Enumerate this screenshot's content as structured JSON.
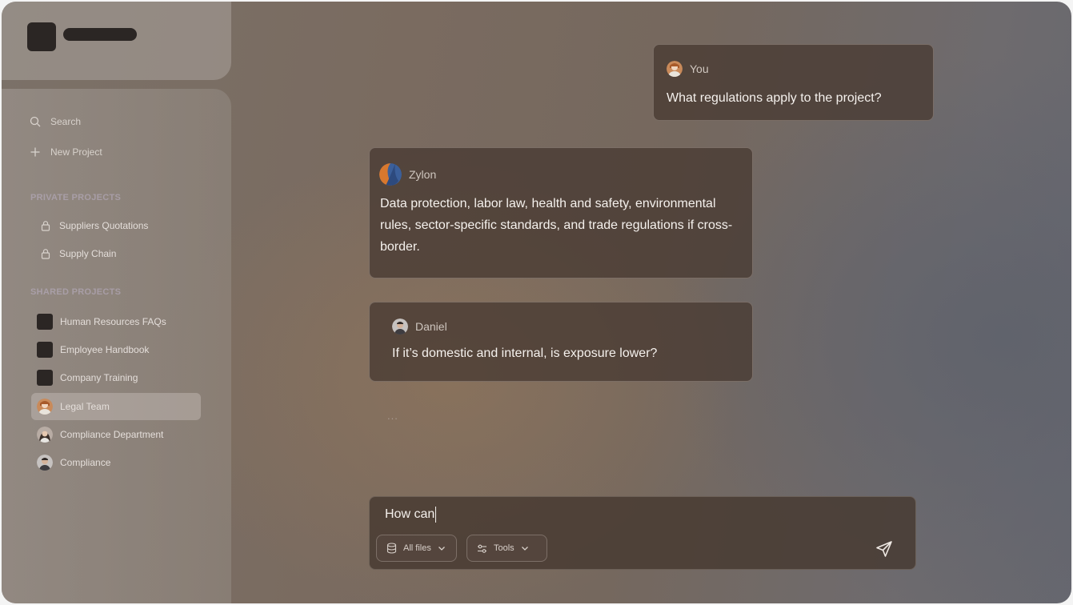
{
  "sidebar": {
    "search_label": "Search",
    "new_project_label": "New Project",
    "private_section_label": "PRIVATE PROJECTS",
    "private_projects": [
      {
        "label": "Suppliers Quotations",
        "icon": "lock-icon"
      },
      {
        "label": "Supply Chain",
        "icon": "lock-icon"
      }
    ],
    "shared_section_label": "SHARED PROJECTS",
    "shared_projects": [
      {
        "label": "Human Resources FAQs",
        "icon": "square"
      },
      {
        "label": "Employee Handbook",
        "icon": "square"
      },
      {
        "label": "Company Training",
        "icon": "square"
      },
      {
        "label": "Legal Team",
        "icon": "avatar",
        "active": true
      },
      {
        "label": "Compliance Department",
        "icon": "avatar"
      },
      {
        "label": "Compliance",
        "icon": "avatar"
      }
    ]
  },
  "chat": {
    "messages": [
      {
        "author": "You",
        "text": "What regulations apply to the project?"
      },
      {
        "author": "Zylon",
        "text": "Data protection, labor law, health and safety, environmental rules, sector-specific standards, and trade regulations if cross-border."
      },
      {
        "author": "Daniel",
        "text": "If it’s domestic and internal, is exposure lower?"
      }
    ],
    "typing_indicator": "..."
  },
  "composer": {
    "value": "How can",
    "files_label": "All files",
    "tools_label": "Tools"
  },
  "colors": {
    "bubble_bg": "#483a32",
    "sidebar_text": "#d8d2cc",
    "section_label": "#beb2c8",
    "logo_dark": "#2b2624"
  }
}
